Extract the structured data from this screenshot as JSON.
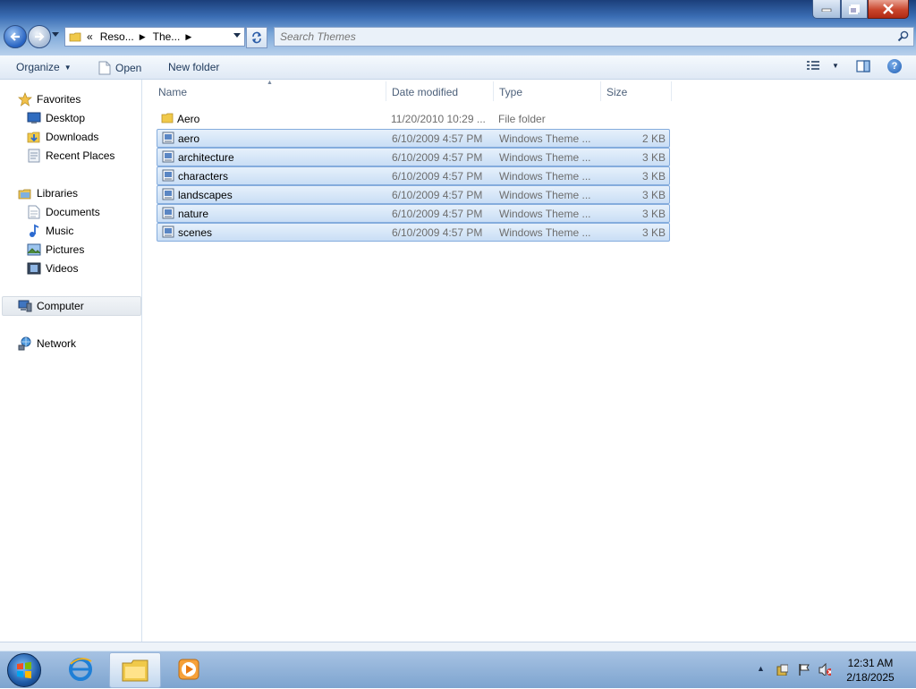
{
  "window": {
    "address_parts": [
      "Reso...",
      "The..."
    ],
    "address_overflow": "«",
    "search_placeholder": "Search Themes"
  },
  "command_bar": {
    "organize_label": "Organize",
    "open_label": "Open",
    "new_folder_label": "New folder"
  },
  "nav_pane": {
    "favorites": {
      "label": "Favorites",
      "items": [
        "Desktop",
        "Downloads",
        "Recent Places"
      ]
    },
    "libraries": {
      "label": "Libraries",
      "items": [
        "Documents",
        "Music",
        "Pictures",
        "Videos"
      ]
    },
    "computer_label": "Computer",
    "network_label": "Network"
  },
  "file_list": {
    "columns": [
      "Name",
      "Date modified",
      "Type",
      "Size"
    ],
    "rows": [
      {
        "name": "Aero",
        "date": "11/20/2010 10:29 ...",
        "type": "File folder",
        "size": "",
        "icon": "folder-icon",
        "selected": false
      },
      {
        "name": "aero",
        "date": "6/10/2009 4:57 PM",
        "type": "Windows Theme ...",
        "size": "2 KB",
        "icon": "theme-file-icon",
        "selected": true
      },
      {
        "name": "architecture",
        "date": "6/10/2009 4:57 PM",
        "type": "Windows Theme ...",
        "size": "3 KB",
        "icon": "theme-file-icon",
        "selected": true
      },
      {
        "name": "characters",
        "date": "6/10/2009 4:57 PM",
        "type": "Windows Theme ...",
        "size": "3 KB",
        "icon": "theme-file-icon",
        "selected": true
      },
      {
        "name": "landscapes",
        "date": "6/10/2009 4:57 PM",
        "type": "Windows Theme ...",
        "size": "3 KB",
        "icon": "theme-file-icon",
        "selected": true
      },
      {
        "name": "nature",
        "date": "6/10/2009 4:57 PM",
        "type": "Windows Theme ...",
        "size": "3 KB",
        "icon": "theme-file-icon",
        "selected": true
      },
      {
        "name": "scenes",
        "date": "6/10/2009 4:57 PM",
        "type": "Windows Theme ...",
        "size": "3 KB",
        "icon": "theme-file-icon",
        "selected": true
      }
    ]
  },
  "taskbar": {
    "clock_time": "12:31 AM",
    "clock_date": "2/18/2025"
  },
  "colors": {
    "selection": "#cce0f6",
    "selection_border": "#84acdd",
    "link_text": "#1e395b"
  }
}
